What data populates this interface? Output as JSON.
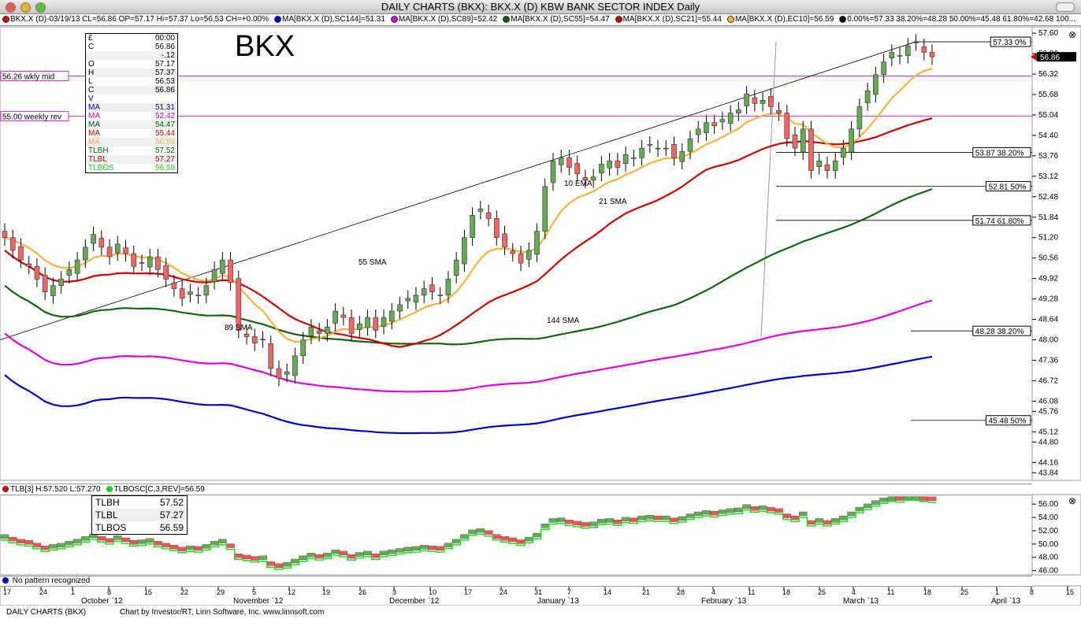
{
  "window": {
    "title": "DAILY CHARTS (BKX): BKX.X (D) KBW BANK SECTOR INDEX Daily"
  },
  "legend": [
    {
      "color": "#cc0000",
      "text": "BKX.X (D)-03/19/13 CL=56.86 OP=57.17 Hi=57.37 Lo=56.53 CH=+0.00%"
    },
    {
      "color": "#0000cc",
      "text": "MA[BKX.X (D),SC144]=51.31"
    },
    {
      "color": "#dd00dd",
      "text": "MA[BKX.X (D),SC89]=52.42"
    },
    {
      "color": "#006600",
      "text": "MA[BKX.X (D),SC55]=54.47"
    },
    {
      "color": "#cc0000",
      "text": "MA[BKX.X (D),SC21]=55.44"
    },
    {
      "color": "#f5b342",
      "text": "MA[BKX.X (D),EC10]=56.59"
    },
    {
      "color": "#000000",
      "text": "0.00%=57.33 38.20%=48.28 50.00%=45.48 61.80%=42.68 100..."
    }
  ],
  "chart_title": "BKX",
  "data_box": {
    "header_symbol": "£",
    "header_time": "00:00",
    "rows": [
      {
        "label": "C",
        "value": "56.86",
        "color": "#000000"
      },
      {
        "label": "",
        "value": "-.12",
        "color": "#000000"
      },
      {
        "label": "O",
        "value": "57.17",
        "color": "#000000"
      },
      {
        "label": "H",
        "value": "57.37",
        "color": "#000000"
      },
      {
        "label": "L",
        "value": "56.53",
        "color": "#000000"
      },
      {
        "label": "C",
        "value": "56.86",
        "color": "#000000"
      },
      {
        "label": "V",
        "value": "",
        "color": "#000000"
      },
      {
        "label": "MA",
        "value": "51.31",
        "color": "#0000cc"
      },
      {
        "label": "MA",
        "value": "52.42",
        "color": "#dd00dd"
      },
      {
        "label": "MA",
        "value": "54.47",
        "color": "#006600"
      },
      {
        "label": "MA",
        "value": "55.44",
        "color": "#cc0000"
      },
      {
        "label": "MA",
        "value": "56.59",
        "color": "#f5b342"
      },
      {
        "label": "TLBH",
        "value": "57.52",
        "color": "#006600"
      },
      {
        "label": "TLBL",
        "value": "57.27",
        "color": "#cc0000"
      },
      {
        "label": "TLBOS",
        "value": "56.59",
        "color": "#22cc22"
      }
    ]
  },
  "level_labels": {
    "weekly_mid": "56.26 wkly mid",
    "weekly_rev": "55.00 weekly rev",
    "price_flag": "56.86"
  },
  "fib_labels": [
    "57.33 0%",
    "53.87 38.20%",
    "52.81 50%",
    "51.74 61.80%",
    "48.28 38.20%",
    "45.48 50%"
  ],
  "ma_labels": [
    "10 EMA",
    "21 SMA",
    "55 SMA",
    "89 SMA",
    "144 SMA"
  ],
  "lower_legend": [
    {
      "color": "#cc0000",
      "text": "TLB[3] H:57.520 L:57.270"
    },
    {
      "color": "#22cc22",
      "text": "TLBOSC[C,3,REV]=56.59"
    }
  ],
  "lower_box": [
    {
      "label": "TLBH",
      "value": "57.52"
    },
    {
      "label": "TLBL",
      "value": "57.27"
    },
    {
      "label": "TLBOS",
      "value": "56.59"
    }
  ],
  "pattern_text": "No pattern recognized",
  "footer": {
    "left": "DAILY CHARTS (BKX)",
    "credit": "Chart by Investor/RT, Linn Software, Inc. www.linnsoft.com"
  },
  "chart_data": [
    {
      "type": "candlestick",
      "title": "BKX",
      "y_ticks": [
        "57.60",
        "56.96",
        "56.32",
        "55.68",
        "55.04",
        "54.40",
        "53.76",
        "53.12",
        "52.48",
        "51.84",
        "51.20",
        "50.56",
        "49.92",
        "49.28",
        "48.64",
        "48.00",
        "47.36",
        "46.72",
        "46.08",
        "45.76",
        "45.12",
        "44.80",
        "44.16",
        "43.84"
      ],
      "ylim": [
        43.6,
        57.8
      ],
      "x_ticks": [
        "17",
        "24",
        "1",
        "8",
        "15",
        "22",
        "29",
        "5",
        "12",
        "19",
        "26",
        "3",
        "10",
        "17",
        "24",
        "31",
        "7",
        "14",
        "21",
        "28",
        "4",
        "11",
        "18",
        "25",
        "4",
        "11",
        "18",
        "25",
        "1",
        "8",
        "15"
      ],
      "x_months": [
        "October `12",
        "November `12",
        "December `12",
        "January `13",
        "February `13",
        "March `13",
        "April `13"
      ],
      "horizontal_levels": [
        56.26,
        55.0
      ],
      "fib_levels": [
        57.33,
        53.87,
        52.81,
        51.74,
        48.28,
        45.48
      ],
      "close": [
        51.2,
        50.8,
        50.5,
        50.3,
        49.9,
        49.5,
        49.7,
        49.9,
        50.2,
        50.5,
        50.9,
        51.3,
        50.9,
        50.6,
        51.0,
        50.7,
        50.3,
        50.4,
        50.6,
        50.2,
        49.9,
        49.6,
        49.3,
        49.5,
        49.4,
        49.7,
        50.2,
        50.5,
        49.8,
        48.3,
        48.1,
        47.9,
        48.0,
        47.1,
        46.8,
        47.0,
        47.5,
        48.0,
        48.4,
        48.2,
        48.4,
        48.9,
        48.7,
        48.2,
        48.5,
        48.7,
        48.3,
        48.7,
        48.9,
        49.1,
        49.3,
        49.4,
        49.6,
        49.5,
        49.4,
        49.9,
        50.5,
        51.2,
        51.9,
        52.1,
        51.8,
        51.2,
        50.9,
        50.7,
        50.4,
        50.8,
        51.4,
        52.8,
        53.6,
        53.7,
        53.4,
        53.2,
        53.0,
        53.1,
        53.5,
        53.6,
        53.4,
        53.8,
        53.7,
        54.0,
        54.1,
        54.0,
        54.0,
        53.7,
        53.9,
        54.3,
        54.6,
        54.8,
        54.7,
        54.9,
        55.1,
        55.2,
        55.7,
        55.4,
        55.5,
        55.3,
        55.1,
        54.3,
        54.0,
        54.6,
        53.3,
        53.6,
        53.3,
        53.6,
        54.0,
        54.6,
        55.3,
        55.8,
        56.3,
        56.7,
        57.0,
        56.9,
        57.2,
        57.3,
        57.0,
        56.86
      ]
    },
    {
      "type": "step",
      "name": "TLB",
      "y_ticks": [
        "56.00",
        "54.00",
        "52.00",
        "50.00",
        "48.00",
        "46.00"
      ],
      "ylim": [
        45.6,
        57.2
      ]
    }
  ]
}
